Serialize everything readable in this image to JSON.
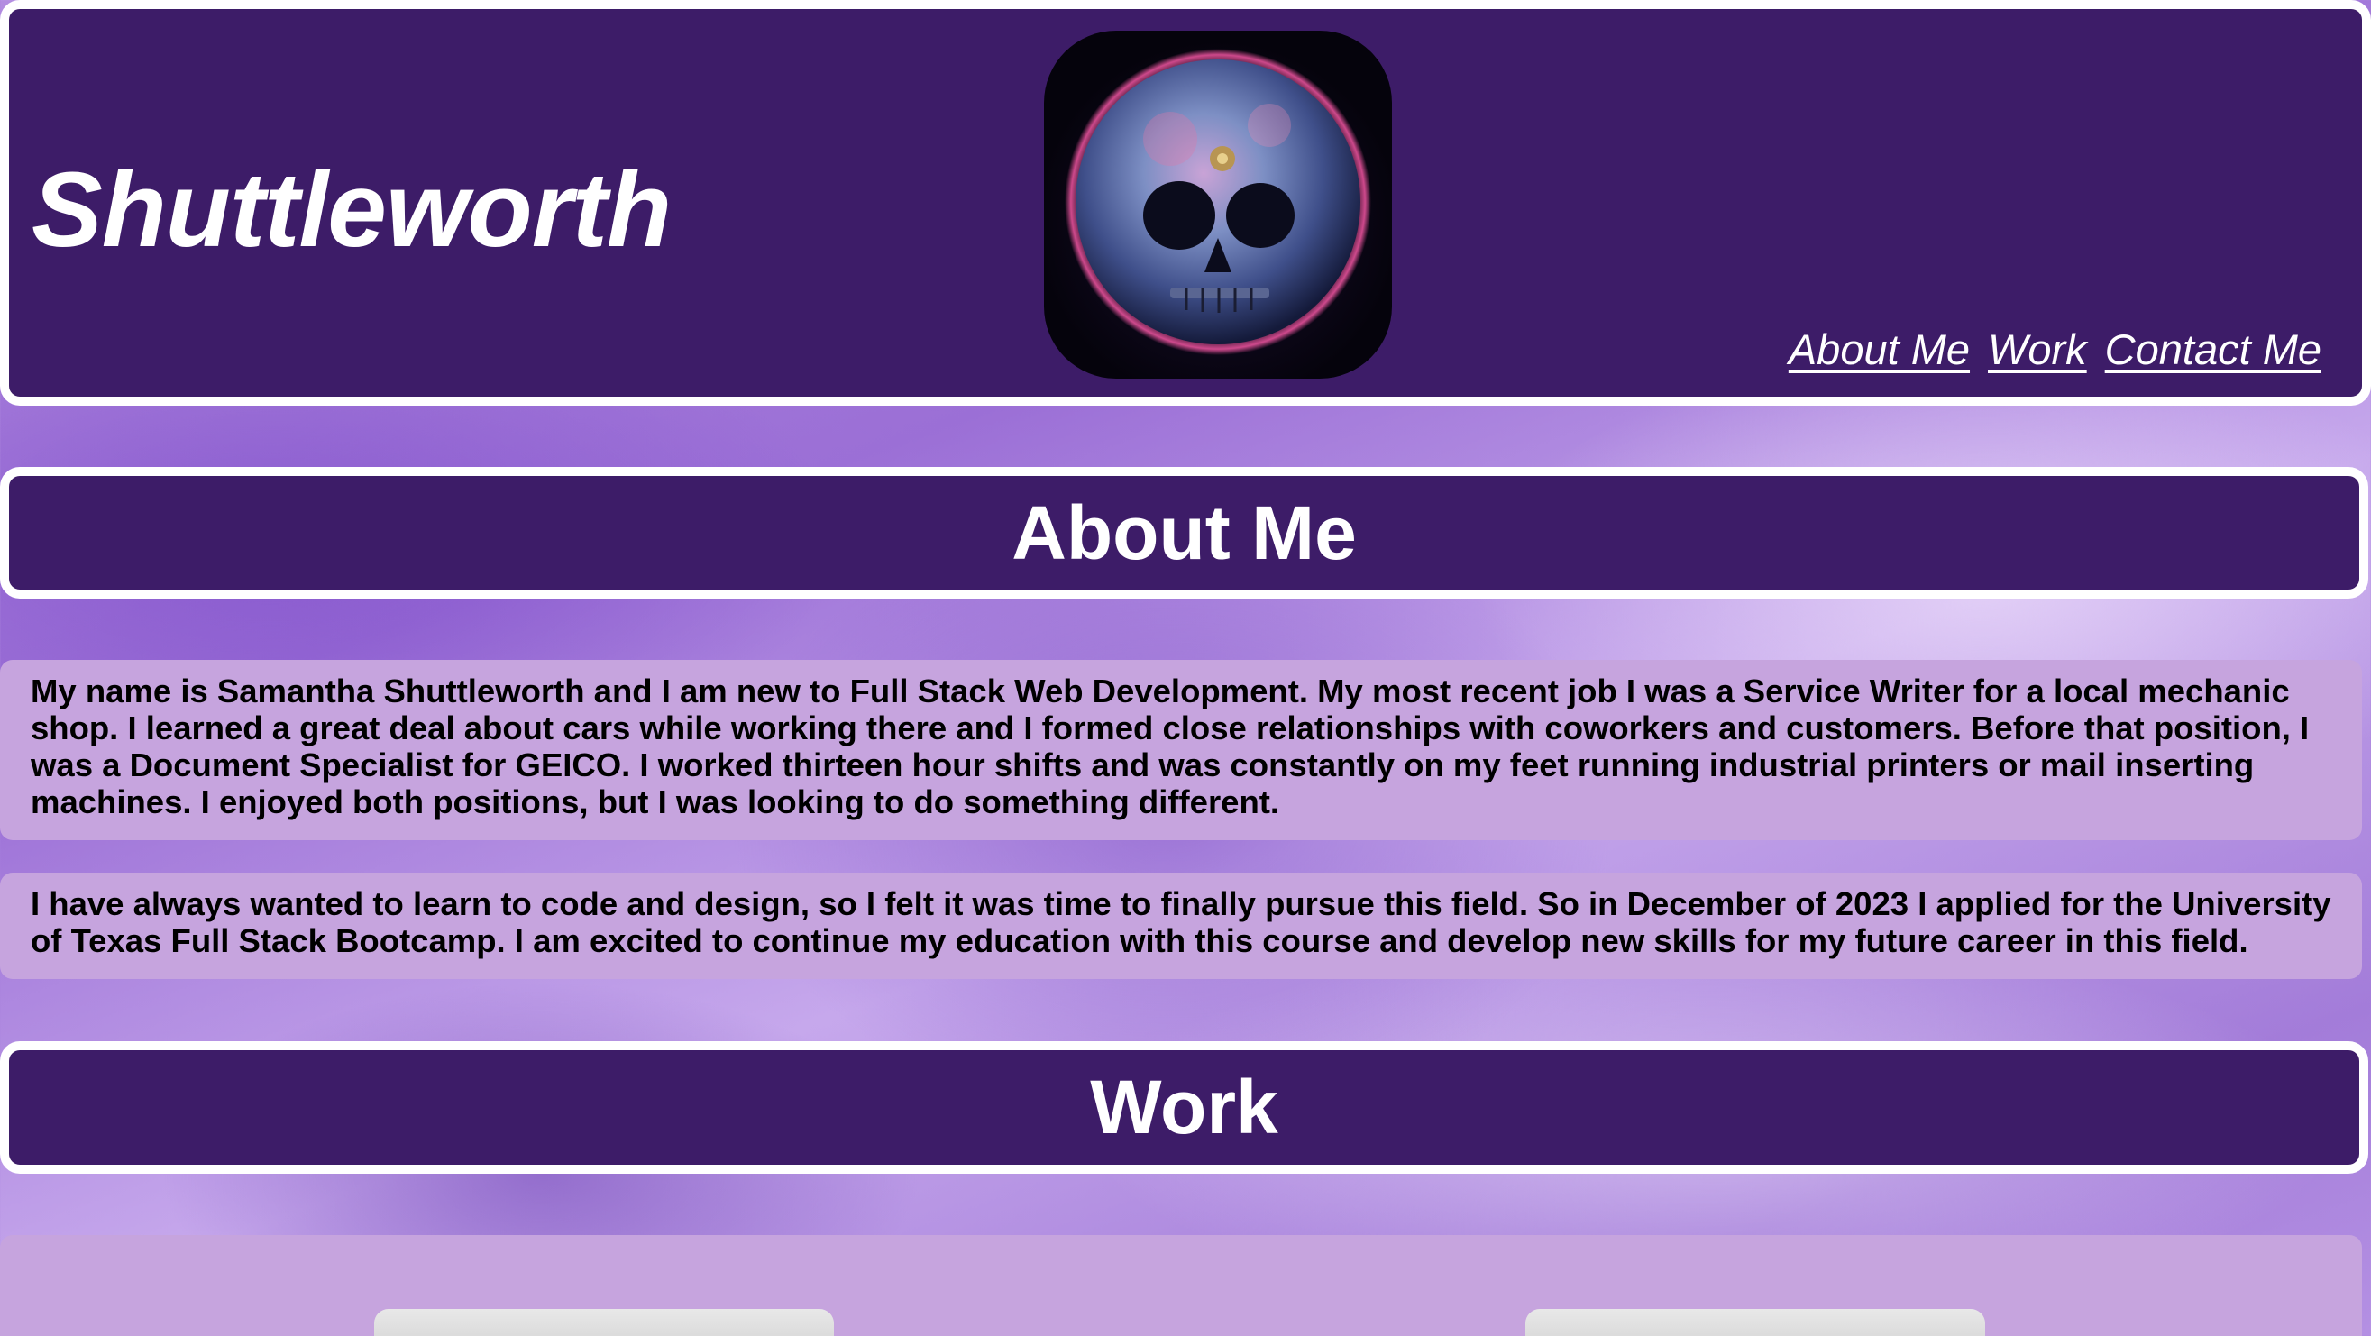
{
  "header": {
    "title": "Shuttleworth",
    "logo_icon": "skull-planet-icon",
    "nav": [
      {
        "label": "About Me"
      },
      {
        "label": "Work"
      },
      {
        "label": "Contact Me"
      }
    ]
  },
  "about": {
    "heading": "About Me",
    "paragraphs": [
      "My name is Samantha Shuttleworth and I am new to Full Stack Web Development. My most recent job I was a Service Writer for a local mechanic shop. I learned a great deal about cars while working there and I formed close relationships with coworkers and customers. Before that position, I was a Document Specialist for GEICO. I worked thirteen hour shifts and was constantly on my feet running industrial printers or mail inserting machines. I enjoyed both positions, but I was looking to do something different.",
      "I have always wanted to learn to code and design, so I felt it was time to finally pursue this field. So in December of 2023 I applied for the University of Texas Full Stack Bootcamp. I am excited to continue my education with this course and develop new skills for my future career in this field."
    ]
  },
  "work": {
    "heading": "Work"
  },
  "colors": {
    "header_bg": "#3d1c68",
    "border": "#ffffff",
    "panel_bg": "#c6a4de",
    "page_bg": "#a37cd9"
  }
}
